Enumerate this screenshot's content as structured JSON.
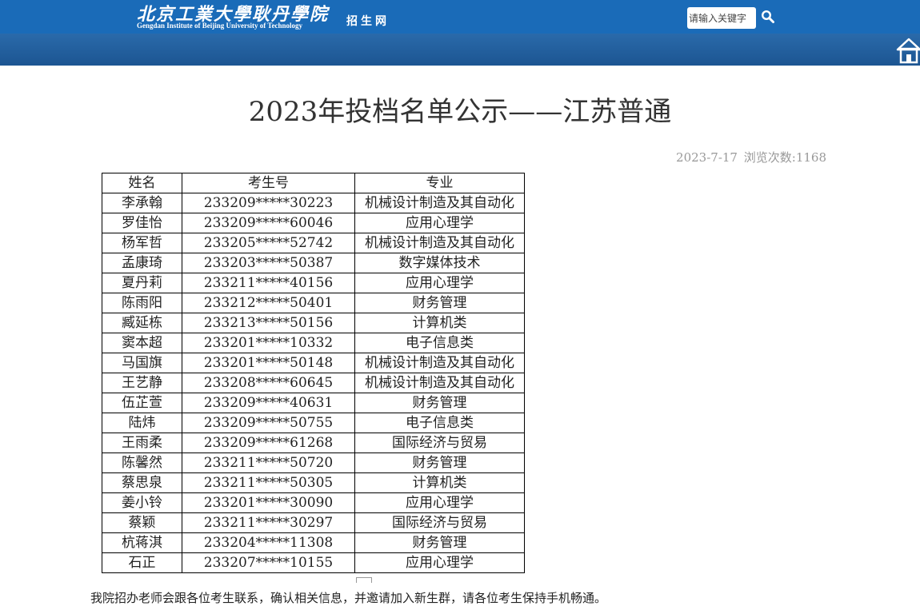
{
  "header": {
    "logo_cn": "北京工業大學耿丹學院",
    "logo_en": "Gengdan Institute of Beijing University of Technology",
    "logo_sub": "招生网",
    "search_placeholder": "请输入关键字"
  },
  "article": {
    "title": "2023年投档名单公示——江苏普通",
    "date": "2023-7-17",
    "views": "浏览次数:1168"
  },
  "table": {
    "headers": [
      "姓名",
      "考生号",
      "专业"
    ],
    "rows": [
      [
        "李承翰",
        "233209*****30223",
        "机械设计制造及其自动化"
      ],
      [
        "罗佳怡",
        "233209*****60046",
        "应用心理学"
      ],
      [
        "杨军哲",
        "233205*****52742",
        "机械设计制造及其自动化"
      ],
      [
        "孟康琦",
        "233203*****50387",
        "数字媒体技术"
      ],
      [
        "夏丹莉",
        "233211*****40156",
        "应用心理学"
      ],
      [
        "陈雨阳",
        "233212*****50401",
        "财务管理"
      ],
      [
        "臧延栋",
        "233213*****50156",
        "计算机类"
      ],
      [
        "窦本超",
        "233201*****10332",
        "电子信息类"
      ],
      [
        "马国旗",
        "233201*****50148",
        "机械设计制造及其自动化"
      ],
      [
        "王艺静",
        "233208*****60645",
        "机械设计制造及其自动化"
      ],
      [
        "伍芷萱",
        "233209*****40631",
        "财务管理"
      ],
      [
        "陆炜",
        "233209*****50755",
        "电子信息类"
      ],
      [
        "王雨柔",
        "233209*****61268",
        "国际经济与贸易"
      ],
      [
        "陈馨然",
        "233211*****50720",
        "财务管理"
      ],
      [
        "蔡思泉",
        "233211*****50305",
        "计算机类"
      ],
      [
        "姜小铃",
        "233201*****30090",
        "应用心理学"
      ],
      [
        "蔡颖",
        "233211*****30297",
        "国际经济与贸易"
      ],
      [
        "杭蒋淇",
        "233204*****11308",
        "财务管理"
      ],
      [
        "石正",
        "233207*****10155",
        "应用心理学"
      ]
    ]
  },
  "footer": {
    "text": "我院招办老师会跟各位考生联系，确认相关信息，并邀请加入新生群，请各位考生保持手机畅通。"
  },
  "colors": {
    "header_blue": "#1a6bb8",
    "header_band": "#1c5592",
    "meta_gray": "#999999"
  }
}
